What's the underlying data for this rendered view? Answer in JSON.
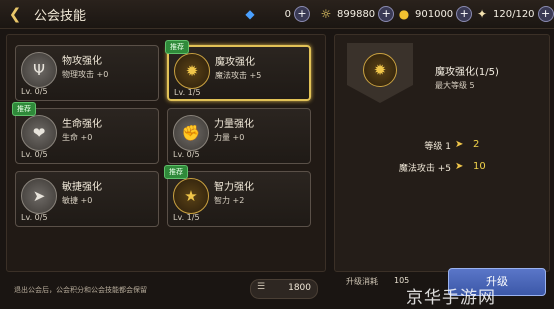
{
  "header": {
    "title": "公会技能",
    "resources": [
      {
        "icon": "crystal-icon",
        "value": "0"
      },
      {
        "icon": "coin-icon",
        "value": "899880"
      },
      {
        "icon": "gold-icon",
        "value": "901000"
      },
      {
        "icon": "stamina-icon",
        "value": "120/120"
      }
    ]
  },
  "skills": [
    {
      "name": "物攻强化",
      "desc": "物理攻击 +0",
      "level": "Lv. 0/5",
      "badge": "",
      "icon": "trident-icon"
    },
    {
      "name": "魔攻强化",
      "desc": "魔法攻击 +5",
      "level": "Lv. 1/5",
      "badge": "推荐",
      "icon": "magic-icon"
    },
    {
      "name": "生命强化",
      "desc": "生命 +0",
      "level": "Lv. 0/5",
      "badge": "推荐",
      "icon": "heart-icon"
    },
    {
      "name": "力量强化",
      "desc": "力量 +0",
      "level": "Lv. 0/5",
      "badge": "",
      "icon": "fist-icon"
    },
    {
      "name": "敏捷强化",
      "desc": "敏捷 +0",
      "level": "Lv. 0/5",
      "badge": "",
      "icon": "boot-icon"
    },
    {
      "name": "智力强化",
      "desc": "智力 +2",
      "level": "Lv. 1/5",
      "badge": "推荐",
      "icon": "candle-icon"
    }
  ],
  "detail": {
    "name": "魔攻强化(1/5)",
    "max_level": "最大等级 5",
    "stats": [
      {
        "label": "等级 1",
        "next": "2"
      },
      {
        "label": "魔法攻击 +5",
        "next": "10"
      }
    ]
  },
  "cost": {
    "label": "升级消耗",
    "value": "105"
  },
  "upgrade_label": "升级",
  "footer": {
    "notice": "退出公会后，公会积分和公会技能都会保留",
    "points": "1800"
  },
  "watermark": "京华手游网"
}
